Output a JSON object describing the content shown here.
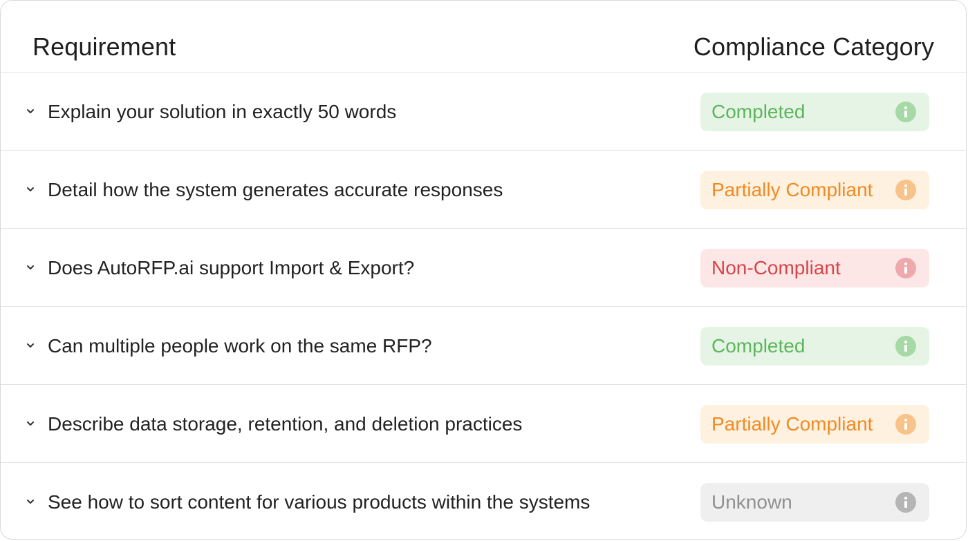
{
  "table": {
    "header": {
      "requirement": "Requirement",
      "compliance_category": "Compliance Category"
    },
    "colors": {
      "completed": {
        "bg": "#e6f4e6",
        "text": "#5bb55b",
        "icon": "#a6d9a6"
      },
      "partial": {
        "bg": "#fff1df",
        "text": "#f08a24",
        "icon": "#f8c38a"
      },
      "non_compliant": {
        "bg": "#fde6e6",
        "text": "#d6454a",
        "icon": "#eda9ab"
      },
      "unknown": {
        "bg": "#efefef",
        "text": "#8f8f8f",
        "icon": "#b5b5b5"
      }
    },
    "rows": [
      {
        "requirement": "Explain your solution in exactly 50 words",
        "status": "Completed",
        "status_key": "completed",
        "icon": "chevron-down-icon"
      },
      {
        "requirement": "Detail how the system generates accurate responses",
        "status": "Partially Compliant",
        "status_key": "partial",
        "icon": "chevron-down-icon"
      },
      {
        "requirement": "Does AutoRFP.ai support Import & Export?",
        "status": "Non-Compliant",
        "status_key": "non_compliant",
        "icon": "chevron-down-icon"
      },
      {
        "requirement": "Can multiple people work on the same RFP?",
        "status": "Completed",
        "status_key": "completed",
        "icon": "chevron-down-icon"
      },
      {
        "requirement": "Describe data storage, retention, and deletion practices",
        "status": "Partially Compliant",
        "status_key": "partial",
        "icon": "chevron-down-icon"
      },
      {
        "requirement": "See how to sort content for various products within the systems",
        "status": "Unknown",
        "status_key": "unknown",
        "icon": "chevron-down-icon"
      }
    ]
  }
}
